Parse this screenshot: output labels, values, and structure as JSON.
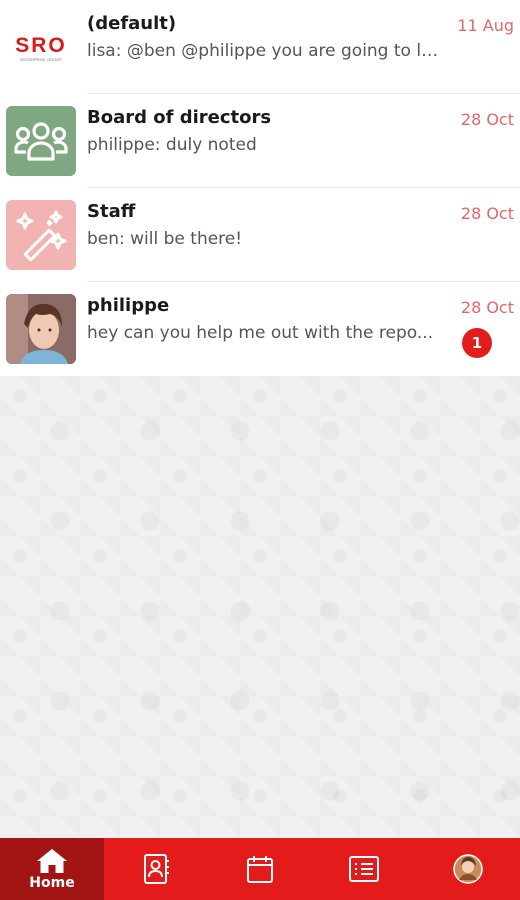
{
  "chats": [
    {
      "title": "(default)",
      "preview": "lisa: @ben @philippe you are going to li...",
      "date": "11 Aug",
      "avatar": "sro-logo",
      "avatar_text": "SRO",
      "avatar_sub": "ENTERPRISE GROUP"
    },
    {
      "title": "Board of directors",
      "preview": "philippe: duly noted",
      "date": "28 Oct",
      "avatar": "group-icon",
      "avatar_bg": "#7fa882"
    },
    {
      "title": "Staff",
      "preview": "ben: will be there!",
      "date": "28 Oct",
      "avatar": "magic-wand-icon",
      "avatar_bg": "#f2b3b3"
    },
    {
      "title": "philippe",
      "preview": "hey can you help me out with the repo...",
      "date": "28 Oct",
      "avatar": "user-photo",
      "unread": "1"
    }
  ],
  "navbar": {
    "items": [
      {
        "icon": "home-icon",
        "label": "Home",
        "active": true
      },
      {
        "icon": "contacts-icon"
      },
      {
        "icon": "calendar-icon"
      },
      {
        "icon": "list-icon"
      },
      {
        "icon": "profile-avatar"
      }
    ]
  },
  "colors": {
    "accent": "#e31b1b",
    "active_nav": "#a31414",
    "date": "#e0686a"
  }
}
